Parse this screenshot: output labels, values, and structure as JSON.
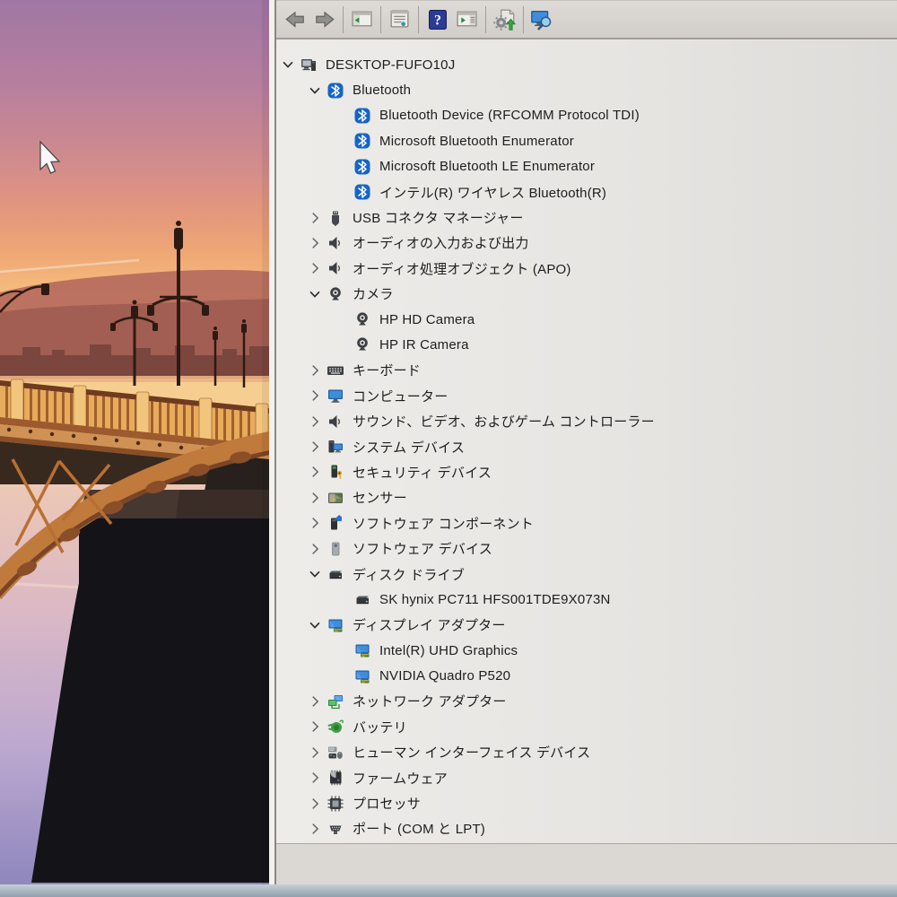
{
  "window": {
    "app": "device-manager",
    "toolbar": {
      "buttons": [
        {
          "name": "back",
          "icon": "back-arrow-icon"
        },
        {
          "name": "forward",
          "icon": "forward-arrow-icon"
        },
        {
          "name": "show-console-tree",
          "icon": "console-tree-icon"
        },
        {
          "name": "properties",
          "icon": "properties-icon"
        },
        {
          "name": "help",
          "icon": "help-icon"
        },
        {
          "name": "show-action-pane",
          "icon": "action-pane-icon"
        },
        {
          "name": "scan-hardware-changes",
          "icon": "scan-hardware-icon"
        },
        {
          "name": "remote-computer-search",
          "icon": "computer-search-icon"
        }
      ]
    },
    "tree": {
      "items": [
        {
          "level": 0,
          "expander": "expanded",
          "icon": "computer",
          "label": "DESKTOP-FUFO10J"
        },
        {
          "level": 1,
          "expander": "expanded",
          "icon": "bluetooth",
          "label": "Bluetooth"
        },
        {
          "level": 2,
          "expander": "none",
          "icon": "bluetooth",
          "label": "Bluetooth Device (RFCOMM Protocol TDI)"
        },
        {
          "level": 2,
          "expander": "none",
          "icon": "bluetooth",
          "label": "Microsoft Bluetooth Enumerator"
        },
        {
          "level": 2,
          "expander": "none",
          "icon": "bluetooth",
          "label": "Microsoft Bluetooth LE Enumerator"
        },
        {
          "level": 2,
          "expander": "none",
          "icon": "bluetooth",
          "label": "インテル(R) ワイヤレス Bluetooth(R)"
        },
        {
          "level": 1,
          "expander": "collapsed",
          "icon": "usb",
          "label": "USB コネクタ マネージャー"
        },
        {
          "level": 1,
          "expander": "collapsed",
          "icon": "audio",
          "label": "オーディオの入力および出力"
        },
        {
          "level": 1,
          "expander": "collapsed",
          "icon": "audio",
          "label": "オーディオ処理オブジェクト (APO)"
        },
        {
          "level": 1,
          "expander": "expanded",
          "icon": "camera",
          "label": "カメラ"
        },
        {
          "level": 2,
          "expander": "none",
          "icon": "camera",
          "label": "HP HD Camera"
        },
        {
          "level": 2,
          "expander": "none",
          "icon": "camera",
          "label": "HP IR Camera"
        },
        {
          "level": 1,
          "expander": "collapsed",
          "icon": "keyboard",
          "label": "キーボード"
        },
        {
          "level": 1,
          "expander": "collapsed",
          "icon": "monitor",
          "label": "コンピューター"
        },
        {
          "level": 1,
          "expander": "collapsed",
          "icon": "audio",
          "label": "サウンド、ビデオ、およびゲーム コントローラー"
        },
        {
          "level": 1,
          "expander": "collapsed",
          "icon": "system",
          "label": "システム デバイス"
        },
        {
          "level": 1,
          "expander": "collapsed",
          "icon": "security",
          "label": "セキュリティ デバイス"
        },
        {
          "level": 1,
          "expander": "collapsed",
          "icon": "sensor",
          "label": "センサー"
        },
        {
          "level": 1,
          "expander": "collapsed",
          "icon": "software-component",
          "label": "ソフトウェア コンポーネント"
        },
        {
          "level": 1,
          "expander": "collapsed",
          "icon": "software-device",
          "label": "ソフトウェア デバイス"
        },
        {
          "level": 1,
          "expander": "expanded",
          "icon": "disk",
          "label": "ディスク ドライブ"
        },
        {
          "level": 2,
          "expander": "none",
          "icon": "disk",
          "label": "SK hynix PC711 HFS001TDE9X073N"
        },
        {
          "level": 1,
          "expander": "expanded",
          "icon": "display",
          "label": "ディスプレイ アダプター"
        },
        {
          "level": 2,
          "expander": "none",
          "icon": "display",
          "label": "Intel(R) UHD Graphics"
        },
        {
          "level": 2,
          "expander": "none",
          "icon": "display",
          "label": "NVIDIA Quadro P520"
        },
        {
          "level": 1,
          "expander": "collapsed",
          "icon": "network",
          "label": "ネットワーク アダプター"
        },
        {
          "level": 1,
          "expander": "collapsed",
          "icon": "battery",
          "label": "バッテリ"
        },
        {
          "level": 1,
          "expander": "collapsed",
          "icon": "hid",
          "label": "ヒューマン インターフェイス デバイス"
        },
        {
          "level": 1,
          "expander": "collapsed",
          "icon": "firmware",
          "label": "ファームウェア"
        },
        {
          "level": 1,
          "expander": "collapsed",
          "icon": "processor",
          "label": "プロセッサ"
        },
        {
          "level": 1,
          "expander": "collapsed",
          "icon": "ports",
          "label": "ポート (COM と LPT)"
        },
        {
          "level": 1,
          "expander": "none",
          "icon": "partial",
          "label": ""
        }
      ]
    }
  },
  "colors": {
    "accent_blue": "#1d5fa8",
    "bluetooth_blue": "#1565c8",
    "help_navy": "#2b3c94",
    "action_green": "#2a8a3e",
    "tree_background": "#e7e5e2",
    "toolbar_background": "#d5d2ce"
  }
}
